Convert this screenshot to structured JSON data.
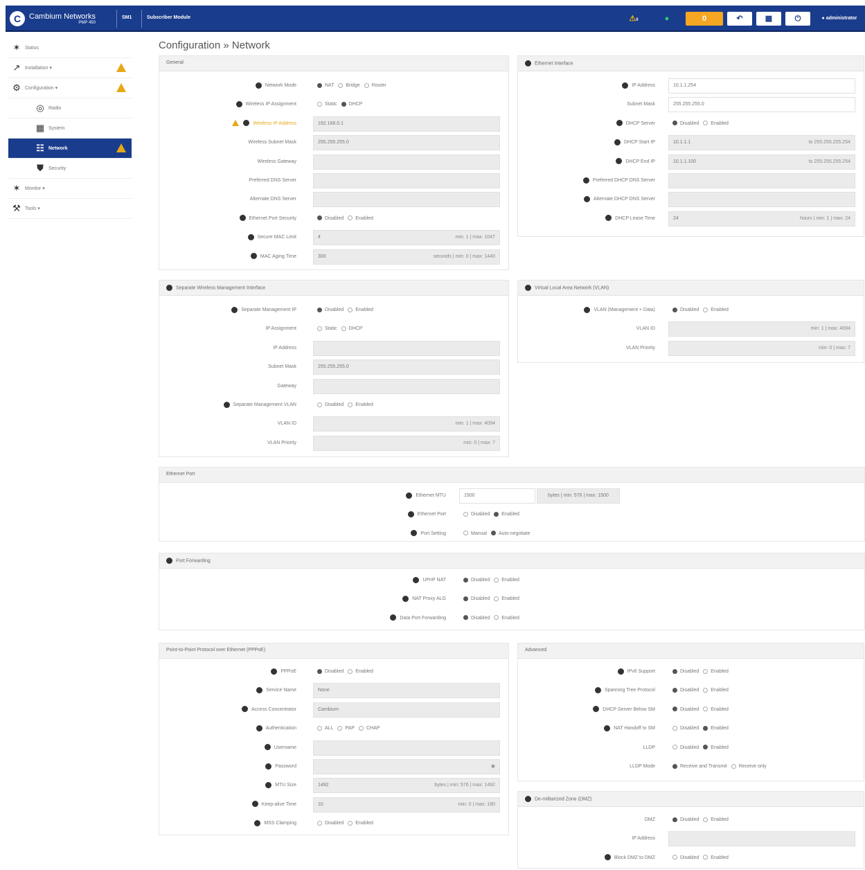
{
  "header": {
    "brand": "Cambium Networks",
    "product": "PMP 450",
    "device": "SM1",
    "mode": "Subscriber Module",
    "user": "administrator",
    "alert_count": "0",
    "sync_label": "0"
  },
  "sidebar": {
    "items": [
      {
        "label": "Status",
        "icon": "pulse-icon",
        "level": 0,
        "warn": false,
        "active": false
      },
      {
        "label": "Installation",
        "icon": "antenna-icon",
        "level": 0,
        "warn": true,
        "active": false
      },
      {
        "label": "Configuration",
        "icon": "gear-icon",
        "level": 0,
        "warn": true,
        "active": false
      },
      {
        "label": "Radio",
        "icon": "globe-icon",
        "level": 1,
        "warn": false,
        "active": false
      },
      {
        "label": "System",
        "icon": "system-icon",
        "level": 1,
        "warn": false,
        "active": false
      },
      {
        "label": "Network",
        "icon": "network-icon",
        "level": 1,
        "warn": true,
        "active": true
      },
      {
        "label": "Security",
        "icon": "shield-icon",
        "level": 1,
        "warn": false,
        "active": false
      },
      {
        "label": "Monitor",
        "icon": "pulse-icon",
        "level": 0,
        "warn": false,
        "active": false
      },
      {
        "label": "Tools",
        "icon": "wrench-icon",
        "level": 0,
        "warn": false,
        "active": false
      }
    ]
  },
  "breadcrumb": {
    "section": "Configuration",
    "sep": "»",
    "page": "Network"
  },
  "general": {
    "title": "General",
    "rows": [
      {
        "label": "Network Mode",
        "info": true,
        "type": "radio",
        "options": [
          "NAT",
          "Bridge",
          "Router"
        ],
        "selected": 0
      },
      {
        "label": "Wireless IP Assignment",
        "info": true,
        "type": "radio",
        "options": [
          "Static",
          "DHCP"
        ],
        "selected": 1
      },
      {
        "label": "Wireless IP Address",
        "info": true,
        "warn": true,
        "type": "input",
        "value": "192.168.0.1"
      },
      {
        "label": "Wireless Subnet Mask",
        "type": "input",
        "value": "255.255.255.0"
      },
      {
        "label": "Wireless Gateway",
        "type": "input",
        "value": ""
      },
      {
        "label": "Preferred DNS Server",
        "type": "input",
        "value": ""
      },
      {
        "label": "Alternate DNS Server",
        "type": "input",
        "value": ""
      },
      {
        "label": "Ethernet Port Security",
        "info": true,
        "type": "radio",
        "options": [
          "Disabled",
          "Enabled"
        ],
        "selected": 0
      },
      {
        "label": "Secure MAC Limit",
        "info": true,
        "type": "input",
        "value": "4",
        "suffix": "min: 1 | max: 1047"
      },
      {
        "label": "MAC Aging Time",
        "info": true,
        "type": "input",
        "value": "300",
        "suffix": "seconds | min: 0 | max: 1440"
      }
    ]
  },
  "eth_iface": {
    "title": "Ethernet Interface",
    "rows": [
      {
        "label": "IP Address",
        "info": true,
        "type": "input",
        "value": "10.1.1.254",
        "white": true
      },
      {
        "label": "Subnet Mask",
        "type": "input",
        "value": "255.255.255.0",
        "white": true
      },
      {
        "label": "DHCP Server",
        "info": true,
        "type": "radio",
        "options": [
          "Disabled",
          "Enabled"
        ],
        "selected": 0
      },
      {
        "label": "DHCP Start IP",
        "info": true,
        "type": "input",
        "value": "10.1.1.1",
        "suffix": "to 255.255.255.254"
      },
      {
        "label": "DHCP End IP",
        "info": true,
        "type": "input",
        "value": "10.1.1.100",
        "suffix": "to 255.255.255.254"
      },
      {
        "label": "Preferred DHCP DNS Server",
        "info": true,
        "type": "input",
        "value": ""
      },
      {
        "label": "Alternate DHCP DNS Server",
        "info": true,
        "type": "input",
        "value": ""
      },
      {
        "label": "DHCP Lease Time",
        "info": true,
        "type": "input",
        "value": "24",
        "suffix": "hours | min: 1 | max: 24"
      }
    ]
  },
  "sep_mgmt": {
    "title": "Separate Wireless Management Interface",
    "rows": [
      {
        "label": "Separate Management IP",
        "info": true,
        "type": "radio",
        "options": [
          "Disabled",
          "Enabled"
        ],
        "selected": 0
      },
      {
        "label": "IP Assignment",
        "type": "radio",
        "options": [
          "Static",
          "DHCP"
        ],
        "selected": -1
      },
      {
        "label": "IP Address",
        "type": "input",
        "value": ""
      },
      {
        "label": "Subnet Mask",
        "type": "input",
        "value": "255.255.255.0"
      },
      {
        "label": "Gateway",
        "type": "input",
        "value": ""
      },
      {
        "label": "Separate Management VLAN",
        "info": true,
        "type": "radio",
        "options": [
          "Disabled",
          "Enabled"
        ],
        "selected": -1
      },
      {
        "label": "VLAN ID",
        "type": "input",
        "value": "",
        "suffix": "min: 1 | max: 4094"
      },
      {
        "label": "VLAN Priority",
        "type": "input",
        "value": "",
        "suffix": "min: 0 | max: 7"
      }
    ]
  },
  "vlan": {
    "title": "Virtual Local Area Network (VLAN)",
    "rows": [
      {
        "label": "VLAN (Management + Data)",
        "info": true,
        "type": "radio",
        "options": [
          "Disabled",
          "Enabled"
        ],
        "selected": 0
      },
      {
        "label": "VLAN ID",
        "type": "input",
        "value": "",
        "suffix": "min: 1 | max: 4094"
      },
      {
        "label": "VLAN Priority",
        "type": "input",
        "value": "",
        "suffix": "min: 0 | max: 7"
      }
    ]
  },
  "eth_port": {
    "title": "Ethernet Port",
    "rows": [
      {
        "label": "Ethernet MTU",
        "info": true,
        "type": "input",
        "value": "1500",
        "white": true,
        "suffix": "bytes | min: 576 | max: 1500"
      },
      {
        "label": "Ethernet Port",
        "info": true,
        "type": "radio",
        "options": [
          "Disabled",
          "Enabled"
        ],
        "selected": 1
      },
      {
        "label": "Port Setting",
        "info": true,
        "type": "radio",
        "options": [
          "Manual",
          "Auto-negotiate"
        ],
        "selected": 1
      }
    ]
  },
  "port_fwd": {
    "title": "Port Forwarding",
    "rows": [
      {
        "label": "UPnP NAT",
        "info": true,
        "type": "radio",
        "options": [
          "Disabled",
          "Enabled"
        ],
        "selected": 0
      },
      {
        "label": "NAT Proxy ALG",
        "info": true,
        "type": "radio",
        "options": [
          "Disabled",
          "Enabled"
        ],
        "selected": 0
      },
      {
        "label": "Data Port Forwarding",
        "info": true,
        "type": "radio",
        "options": [
          "Disabled",
          "Enabled"
        ],
        "selected": 0
      }
    ]
  },
  "pppoe": {
    "title": "Point-to-Point Protocol over Ethernet (PPPoE)",
    "rows": [
      {
        "label": "PPPoE",
        "info": true,
        "type": "radio",
        "options": [
          "Disabled",
          "Enabled"
        ],
        "selected": 0
      },
      {
        "label": "Service Name",
        "info": true,
        "type": "input",
        "value": "None"
      },
      {
        "label": "Access Concentrator",
        "info": true,
        "type": "input",
        "value": "Cambium"
      },
      {
        "label": "Authentication",
        "info": true,
        "type": "radio",
        "options": [
          "ALL",
          "PAP",
          "CHAP"
        ],
        "selected": -1
      },
      {
        "label": "Username",
        "info": true,
        "type": "input",
        "value": ""
      },
      {
        "label": "Password",
        "info": true,
        "type": "input",
        "value": "",
        "eye": true
      },
      {
        "label": "MTU Size",
        "info": true,
        "type": "input",
        "value": "1492",
        "suffix": "bytes | min: 576 | max: 1492"
      },
      {
        "label": "Keep-alive Time",
        "info": true,
        "type": "input",
        "value": "10",
        "suffix": "min: 0 | max: 180"
      },
      {
        "label": "MSS Clamping",
        "info": true,
        "type": "radio",
        "options": [
          "Disabled",
          "Enabled"
        ],
        "selected": -1
      }
    ]
  },
  "advanced": {
    "title": "Advanced",
    "rows": [
      {
        "label": "IPv6 Support",
        "info": true,
        "type": "radio",
        "options": [
          "Disabled",
          "Enabled"
        ],
        "selected": 0
      },
      {
        "label": "Spanning Tree Protocol",
        "info": true,
        "type": "radio",
        "options": [
          "Disabled",
          "Enabled"
        ],
        "selected": 0
      },
      {
        "label": "DHCP Server Below SM",
        "info": true,
        "type": "radio",
        "options": [
          "Disabled",
          "Enabled"
        ],
        "selected": 0
      },
      {
        "label": "NAT Handoff to SM",
        "info": true,
        "type": "radio",
        "options": [
          "Disabled",
          "Enabled"
        ],
        "selected": 1
      },
      {
        "label": "LLDP",
        "type": "radio",
        "options": [
          "Disabled",
          "Enabled"
        ],
        "selected": 1
      },
      {
        "label": "LLDP Mode",
        "type": "radio",
        "options": [
          "Receive and Transmit",
          "Receive only"
        ],
        "selected": 0
      }
    ]
  },
  "dmz": {
    "title": "De-militarized Zone (DMZ)",
    "rows": [
      {
        "label": "DMZ",
        "type": "radio",
        "options": [
          "Disabled",
          "Enabled"
        ],
        "selected": 0
      },
      {
        "label": "IP Address",
        "type": "input",
        "value": ""
      },
      {
        "label": "Block DMZ to DMZ",
        "info": true,
        "type": "radio",
        "options": [
          "Disabled",
          "Enabled"
        ],
        "selected": -1
      }
    ]
  }
}
